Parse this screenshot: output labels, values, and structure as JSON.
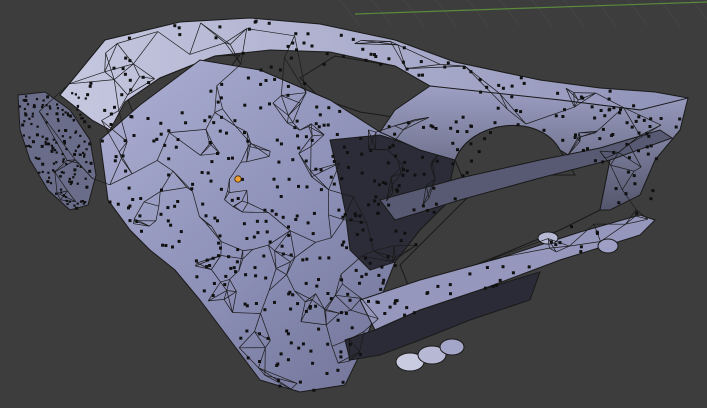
{
  "viewport": {
    "mode": "edit-mode-face-select",
    "background_color": "#3d3d3d",
    "grid_color": "#4a4a4a",
    "axis_x_color": "#5a8a3c",
    "mesh": {
      "object": "car-body-shell",
      "face_color": "#8c90b6",
      "face_shade_light": "#c9cbe0",
      "face_shade_mid": "#9a9dc2",
      "face_shade_dark": "#4b4d64",
      "edge_color": "#1a1a1a",
      "face_dot_color": "#101010",
      "origin_color": "#f0a030"
    }
  }
}
